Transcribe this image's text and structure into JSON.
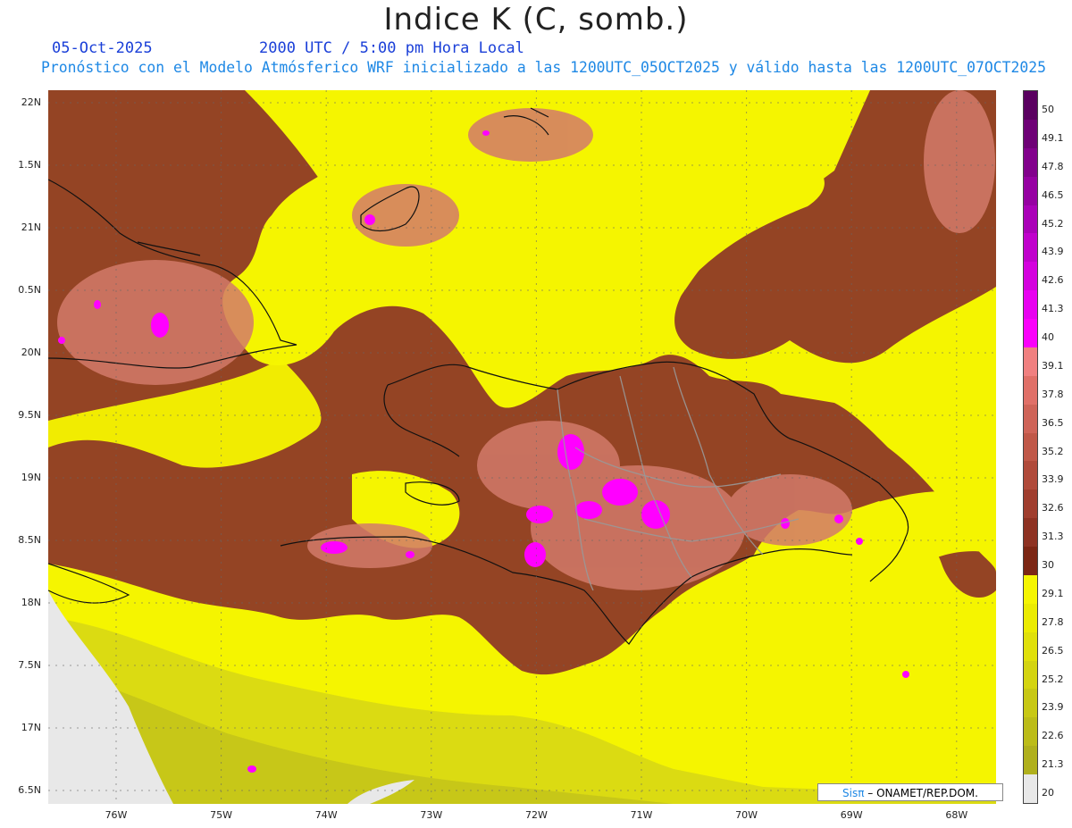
{
  "header": {
    "title": "Indice K (C, somb.)",
    "date": "05-Oct-2025",
    "time": "2000 UTC / 5:00 pm Hora Local",
    "subtitle": "Pronóstico con el Modelo Atmósferico WRF inicializado a las 1200UTC_05OCT2025 y válido hasta las  1200UTC_07OCT2025"
  },
  "map": {
    "lat_labels": [
      "22N",
      "1.5N",
      "21N",
      "0.5N",
      "20N",
      "9.5N",
      "19N",
      "8.5N",
      "18N",
      "7.5N",
      "17N",
      "6.5N"
    ],
    "lon_labels": [
      "76W",
      "75W",
      "74W",
      "73W",
      "72W",
      "71W",
      "70W",
      "69W",
      "68W"
    ],
    "lat_range": [
      16.4,
      22.1
    ],
    "lon_range": [
      76.65,
      67.6
    ],
    "grid": "dotted"
  },
  "colorbar": {
    "labels": [
      "50",
      "49.1",
      "47.8",
      "46.5",
      "45.2",
      "43.9",
      "42.6",
      "41.3",
      "40",
      "39.1",
      "37.8",
      "36.5",
      "35.2",
      "33.9",
      "32.6",
      "31.3",
      "30",
      "29.1",
      "27.8",
      "26.5",
      "25.2",
      "23.9",
      "22.6",
      "21.3",
      "20"
    ],
    "colors": [
      "#5a0060",
      "#6e0076",
      "#82008c",
      "#9600a2",
      "#aa00b8",
      "#c000cc",
      "#d400de",
      "#e800f0",
      "#fa00fa",
      "#f08080",
      "#e07068",
      "#cf6458",
      "#c05848",
      "#b04a3a",
      "#a03e2e",
      "#8e3222",
      "#7c2614",
      "#f5f500",
      "#ebeb00",
      "#e0e00a",
      "#d4d410",
      "#c8c814",
      "#bcbc18",
      "#b0b01c",
      "#e8e8e8"
    ],
    "map_colors": {
      "sea_low": "#f5f500",
      "sea_dry": "#cccc18",
      "storm": "#8e3a26",
      "high": "#d27a6a",
      "peak": "#ff00ff",
      "no_data": "#e8e8e8",
      "coast": "#111111",
      "border": "#999999"
    }
  },
  "credit": {
    "brand": "Sisπ",
    "text": " – ONAMET/REP.DOM."
  }
}
